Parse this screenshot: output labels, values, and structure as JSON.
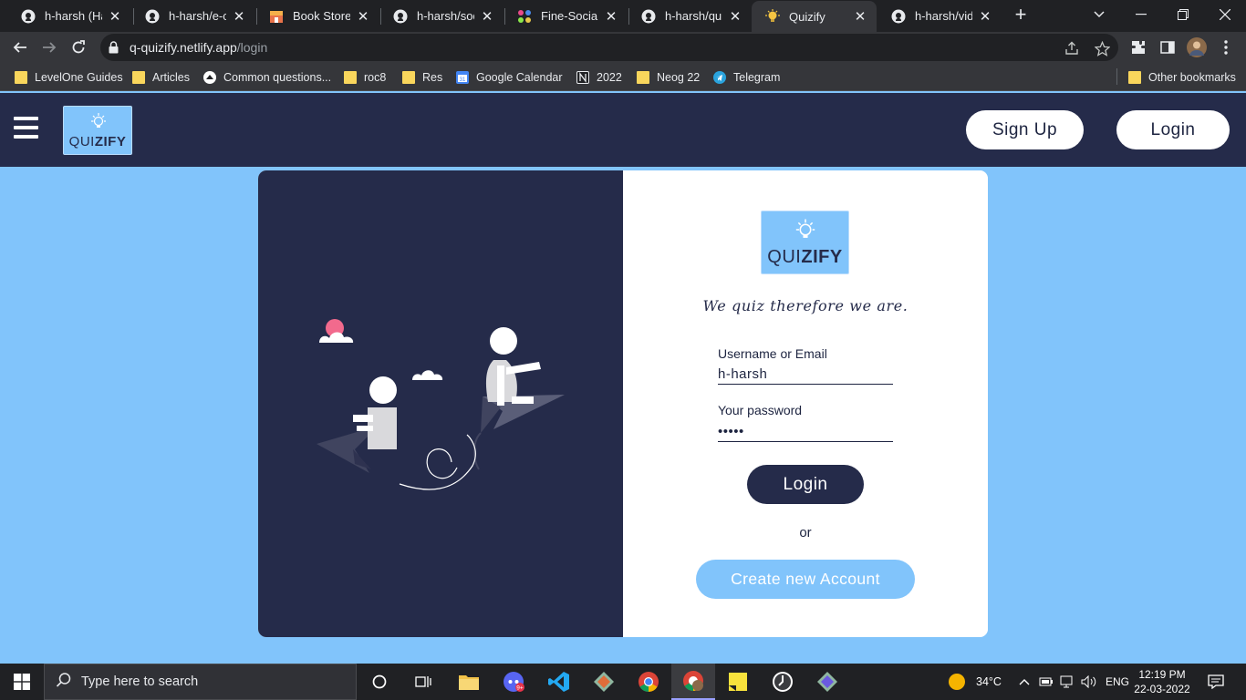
{
  "browser": {
    "tabs": [
      {
        "title": "h-harsh (Hars",
        "icon": "github-icon"
      },
      {
        "title": "h-harsh/e-co",
        "icon": "github-icon"
      },
      {
        "title": "Book Store",
        "icon": "store-icon"
      },
      {
        "title": "h-harsh/socia",
        "icon": "github-icon"
      },
      {
        "title": "Fine-Socials",
        "icon": "dots-icon"
      },
      {
        "title": "h-harsh/quiz",
        "icon": "github-icon"
      },
      {
        "title": "Quizify",
        "icon": "bulb-icon",
        "active": true
      },
      {
        "title": "h-harsh/vide",
        "icon": "github-icon"
      }
    ],
    "url_host": "q-quizify.netlify.app",
    "url_path": "/login",
    "bookmarks": [
      {
        "label": "LevelOne Guides",
        "icon": "folder-icon"
      },
      {
        "label": "Articles",
        "icon": "folder-icon"
      },
      {
        "label": "Common questions...",
        "icon": "page-icon"
      },
      {
        "label": "roc8",
        "icon": "folder-icon"
      },
      {
        "label": "Res",
        "icon": "folder-icon"
      },
      {
        "label": "Google Calendar",
        "icon": "calendar-icon"
      },
      {
        "label": "2022",
        "icon": "notion-icon"
      },
      {
        "label": "Neog 22",
        "icon": "folder-icon"
      },
      {
        "label": "Telegram",
        "icon": "telegram-icon"
      }
    ],
    "other_bookmarks": "Other bookmarks"
  },
  "app": {
    "logo_text_light": "QUI",
    "logo_text_bold": "ZIFY",
    "signup_label": "Sign Up",
    "login_label": "Login"
  },
  "form": {
    "tagline": "We quiz therefore we are.",
    "username_label": "Username or Email",
    "username_value": "h-harsh",
    "password_label": "Your password",
    "password_value": "•••••",
    "login_button": "Login",
    "or_text": "or",
    "create_button": "Create new Account"
  },
  "taskbar": {
    "search_placeholder": "Type here to search",
    "temperature": "34°C",
    "language": "ENG",
    "time": "12:19 PM",
    "date": "22-03-2022"
  },
  "colors": {
    "navy": "#252b4a",
    "sky": "#81c4fb"
  }
}
